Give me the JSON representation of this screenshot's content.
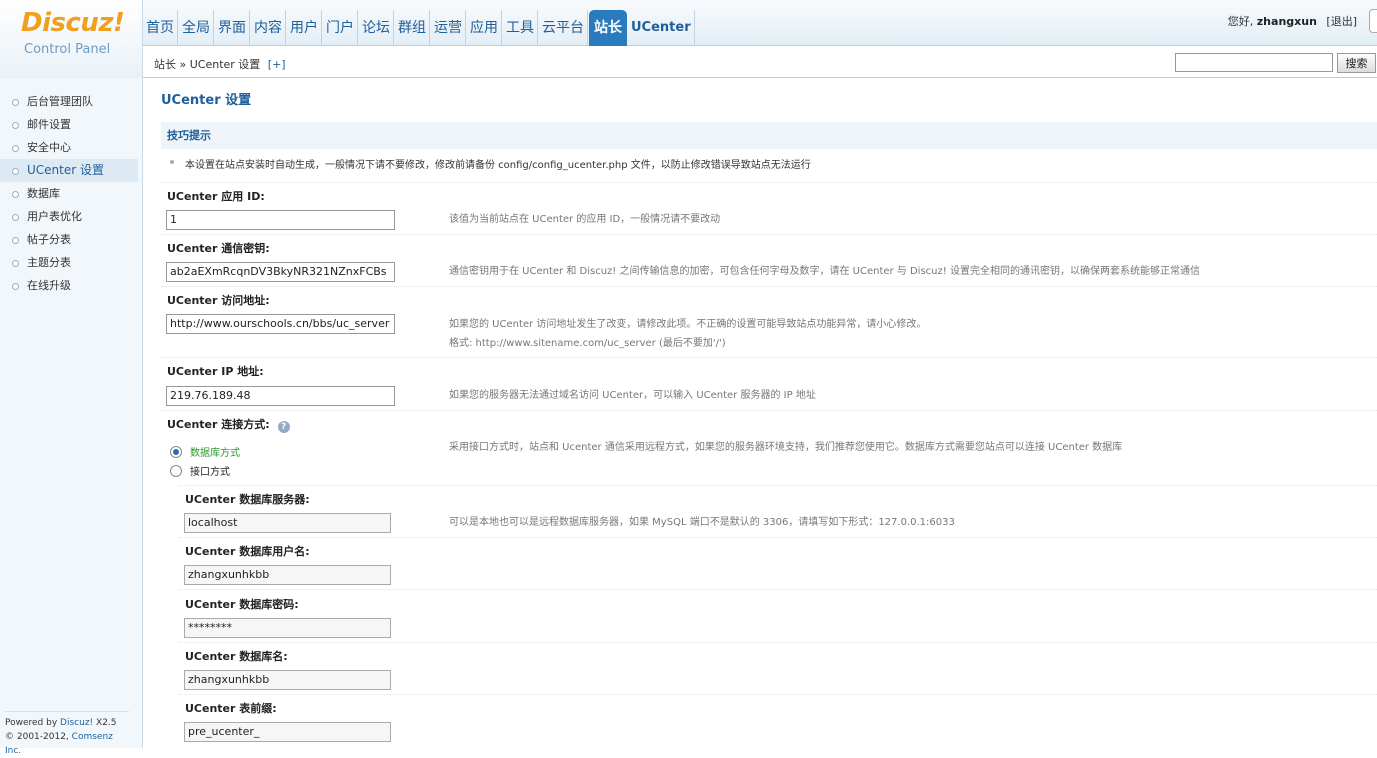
{
  "logo": {
    "title": "Discuz!",
    "subtitle": "Control Panel"
  },
  "nav": {
    "items": [
      "首页",
      "全局",
      "界面",
      "内容",
      "用户",
      "门户",
      "论坛",
      "群组",
      "运营",
      "应用",
      "工具",
      "云平台",
      "站长",
      "UCenter"
    ],
    "active_index": 12
  },
  "user": {
    "greeting": "您好,",
    "name": "zhangxun",
    "logout": "[退出]"
  },
  "breadcrumb": {
    "text": "站长 » UCenter 设置",
    "add": "[+]"
  },
  "search": {
    "placeholder": "",
    "button": "搜索"
  },
  "sidebar": {
    "items": [
      "后台管理团队",
      "邮件设置",
      "安全中心",
      "UCenter 设置",
      "数据库",
      "用户表优化",
      "帖子分表",
      "主题分表",
      "在线升级"
    ],
    "active_index": 3,
    "footer": {
      "powered": "Powered by",
      "brand": "Discuz!",
      "version": "X2.5",
      "copyright_prefix": "© 2001-2012,",
      "company": "Comsenz Inc."
    }
  },
  "page": {
    "title": "UCenter 设置",
    "tip_heading": "技巧提示",
    "tip_text": "本设置在站点安装时自动生成，一般情况下请不要修改，修改前请备份 config/config_ucenter.php 文件，以防止修改错误导致站点无法运行"
  },
  "fields": {
    "app_id": {
      "label": "UCenter 应用 ID:",
      "value": "1",
      "desc": "该值为当前站点在 UCenter 的应用 ID，一般情况请不要改动"
    },
    "key": {
      "label": "UCenter 通信密钥:",
      "value": "ab2aEXmRcqnDV3BkyNR321NZnxFCBs",
      "desc": "通信密钥用于在 UCenter 和 Discuz! 之间传输信息的加密，可包含任何字母及数字，请在 UCenter 与 Discuz! 设置完全相同的通讯密钥，以确保两套系统能够正常通信"
    },
    "url": {
      "label": "UCenter 访问地址:",
      "value": "http://www.ourschools.cn/bbs/uc_server",
      "desc": "如果您的 UCenter 访问地址发生了改变，请修改此项。不正确的设置可能导致站点功能异常，请小心修改。",
      "desc2": "格式: http://www.sitename.com/uc_server (最后不要加'/')"
    },
    "ip": {
      "label": "UCenter IP 地址:",
      "value": "219.76.189.48",
      "desc": "如果您的服务器无法通过域名访问 UCenter，可以输入 UCenter 服务器的 IP 地址"
    },
    "connect": {
      "label": "UCenter 连接方式:",
      "help": "?",
      "options": [
        "数据库方式",
        "接口方式"
      ],
      "selected": 0,
      "desc": "采用接口方式时，站点和 Ucenter 通信采用远程方式，如果您的服务器环境支持，我们推荐您使用它。数据库方式需要您站点可以连接 UCenter 数据库"
    },
    "db_host": {
      "label": "UCenter 数据库服务器:",
      "value": "localhost",
      "desc": "可以是本地也可以是远程数据库服务器，如果 MySQL 端口不是默认的 3306，请填写如下形式：127.0.0.1:6033"
    },
    "db_user": {
      "label": "UCenter 数据库用户名:",
      "value": "zhangxunhkbb"
    },
    "db_pass": {
      "label": "UCenter 数据库密码:",
      "value": "********"
    },
    "db_name": {
      "label": "UCenter 数据库名:",
      "value": "zhangxunhkbb"
    },
    "db_prefix": {
      "label": "UCenter 表前缀:",
      "value": "pre_ucenter_"
    }
  }
}
